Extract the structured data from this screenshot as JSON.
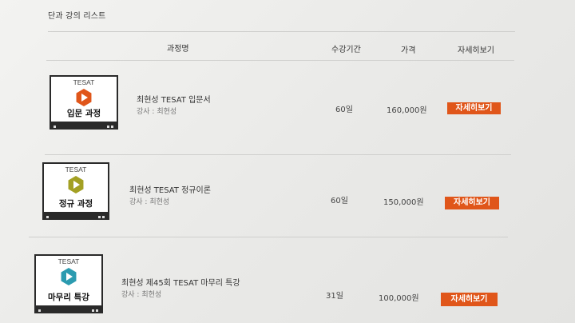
{
  "section_title": "단과 강의 리스트",
  "table_headers": {
    "course_name": "과정명",
    "period": "수강기간",
    "price": "가격",
    "detail": "자세히보기"
  },
  "courses": [
    {
      "thumb_brand": "TESAT",
      "thumb_title": "입문 과정",
      "thumb_icon": "play-hexagon-icon",
      "thumb_color": "#e0561a",
      "title": "최현성 TESAT 입문서",
      "instructor": "강사 : 최현성",
      "period": "60일",
      "price": "160,000원",
      "button": "자세히보기"
    },
    {
      "thumb_brand": "TESAT",
      "thumb_title": "정규 과정",
      "thumb_icon": "play-hexagon-icon",
      "thumb_color": "#a3a023",
      "title": "최현성 TESAT 정규이론",
      "instructor": "강사 : 최현성",
      "period": "60일",
      "price": "150,000원",
      "button": "자세히보기"
    },
    {
      "thumb_brand": "TESAT",
      "thumb_title": "마무리 특강",
      "thumb_icon": "play-hexagon-icon",
      "thumb_color": "#2b9bb0",
      "title": "최현성 제45회 TESAT 마무리 특강",
      "instructor": "강사 : 최현성",
      "period": "31일",
      "price": "100,000원",
      "button": "자세히보기"
    }
  ],
  "colors": {
    "accent": "#e0561a"
  }
}
